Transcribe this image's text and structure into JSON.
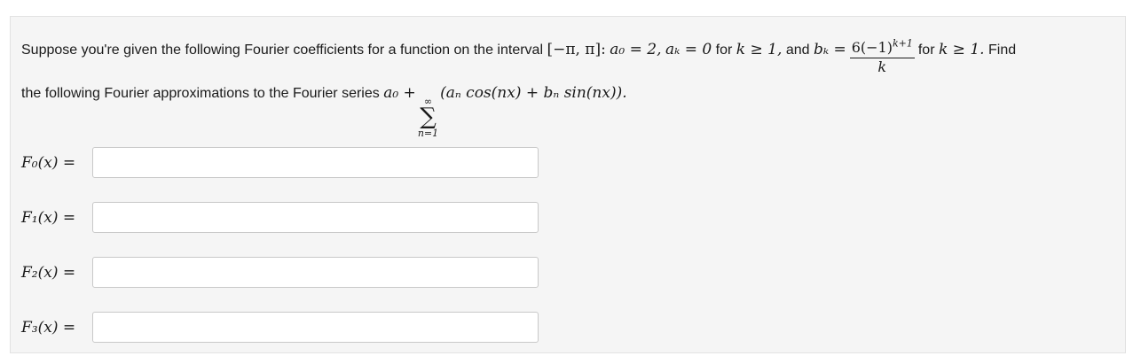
{
  "problem": {
    "intro_text": "Suppose you're given the following Fourier coefficients for a function on the interval",
    "interval": "[−π, π]:",
    "a0_expr": "a₀ = 2,",
    "ak_expr": "aₖ = 0",
    "for_text_1": "for",
    "k_ge_1_expr_1": "k ≥ 1,",
    "and_text": "and",
    "bk_expr": "bₖ =",
    "fraction_numerator": "6(−1)",
    "fraction_numerator_exponent": "k+1",
    "fraction_denominator": "k",
    "for_text_2": "for",
    "k_ge_1_expr_2": "k ≥ 1.",
    "find_text": "Find",
    "line2_text": "the following Fourier approximations to the Fourier series",
    "series_lead": "a₀ +",
    "sum_upper": "∞",
    "sum_symbol": "∑",
    "sum_lower": "n=1",
    "series_body": "(aₙ cos(nx) + bₙ sin(nx)).",
    "answers": [
      {
        "label": "F₀(x) =",
        "value": ""
      },
      {
        "label": "F₁(x) =",
        "value": ""
      },
      {
        "label": "F₂(x) =",
        "value": ""
      },
      {
        "label": "F₃(x) =",
        "value": ""
      }
    ]
  }
}
